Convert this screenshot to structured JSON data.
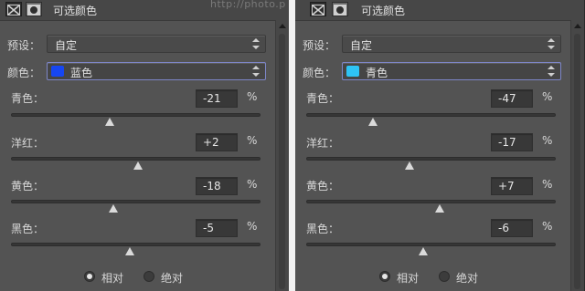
{
  "panels": [
    {
      "title": "可选颜色",
      "preset_label": "预设：",
      "preset_value": "自定",
      "colors_label": "颜色：",
      "colors_value": "蓝色",
      "colors_swatch": "#1646f2",
      "sliders": [
        {
          "label": "青色：",
          "value": "-21",
          "unit": "%",
          "percent": -21
        },
        {
          "label": "洋红：",
          "value": "+2",
          "unit": "%",
          "percent": 2
        },
        {
          "label": "黄色：",
          "value": "-18",
          "unit": "%",
          "percent": -18
        },
        {
          "label": "黑色：",
          "value": "-5",
          "unit": "%",
          "percent": -5
        }
      ],
      "method": {
        "relative_label": "相对",
        "absolute_label": "绝对",
        "selected": "relative"
      }
    },
    {
      "title": "可选颜色",
      "preset_label": "预设：",
      "preset_value": "自定",
      "colors_label": "颜色：",
      "colors_value": "青色",
      "colors_swatch": "#2ec3f5",
      "sliders": [
        {
          "label": "青色：",
          "value": "-47",
          "unit": "%",
          "percent": -47
        },
        {
          "label": "洋红：",
          "value": "-17",
          "unit": "%",
          "percent": -17
        },
        {
          "label": "黄色：",
          "value": "+7",
          "unit": "%",
          "percent": 7
        },
        {
          "label": "黑色：",
          "value": "-6",
          "unit": "%",
          "percent": -6
        }
      ],
      "method": {
        "relative_label": "相对",
        "absolute_label": "绝对",
        "selected": "relative"
      }
    }
  ],
  "watermark": "http://photo.p"
}
